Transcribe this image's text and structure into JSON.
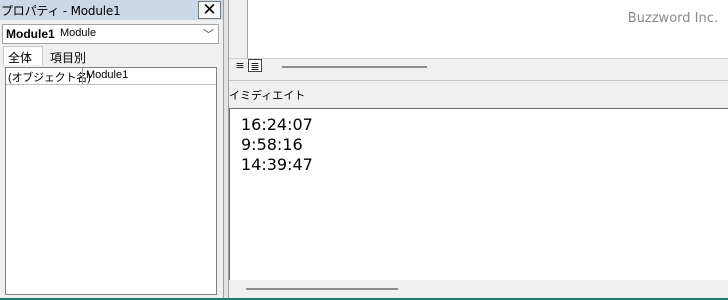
{
  "properties": {
    "title": "プロパティ - Module1",
    "close_label": "✕",
    "object_name": "Module1",
    "object_type": "Module",
    "tabs": [
      "全体",
      "項目別"
    ],
    "rows": [
      {
        "name": "(オブジェクト名)",
        "value": "Module1"
      }
    ]
  },
  "code": {
    "procview_icon": "procedure-view-icon",
    "fullview_icon": "full-module-view-icon",
    "watermark": "Buzzword Inc."
  },
  "immediate": {
    "title": "イミディエイト",
    "lines": [
      "16:24:07",
      "9:58:16",
      "14:39:47"
    ]
  }
}
